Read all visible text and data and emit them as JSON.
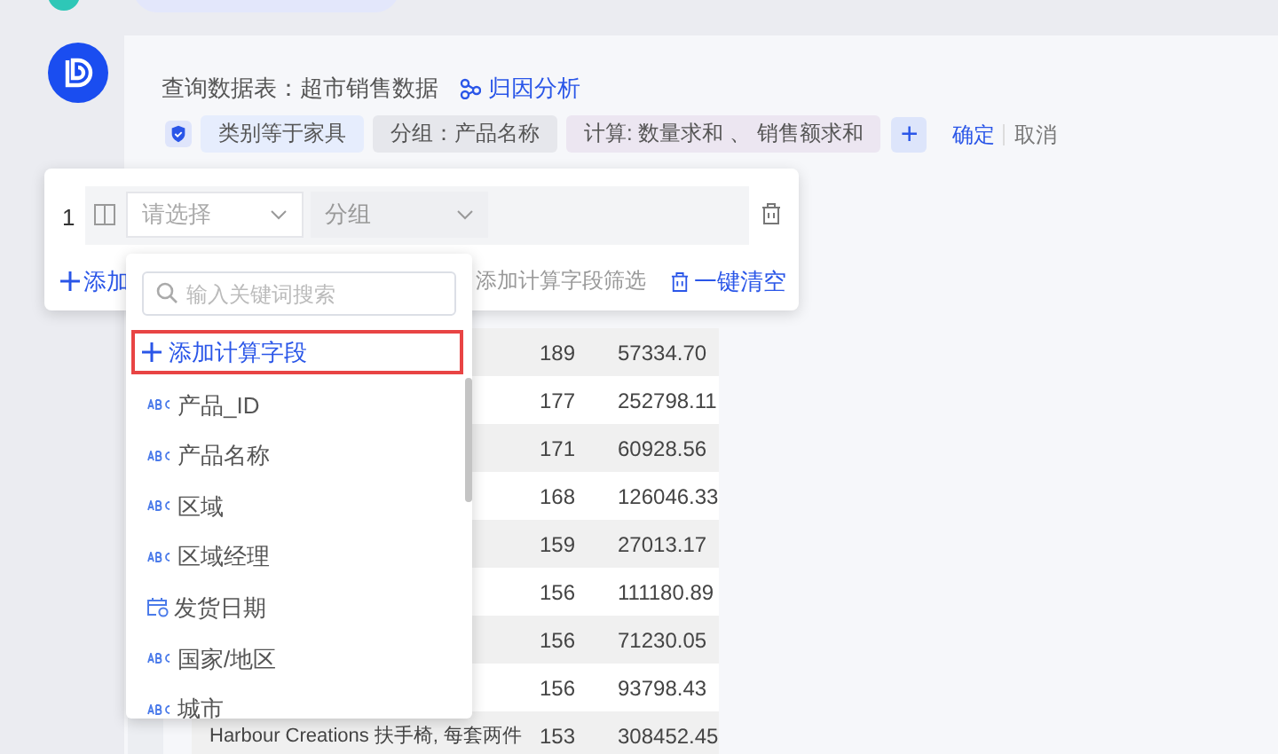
{
  "query": {
    "label": "查询数据表：超市销售数据",
    "link": "归因分析"
  },
  "chips": [
    {
      "kind": "filter",
      "text": "类别等于家具"
    },
    {
      "kind": "group",
      "text": "分组：产品名称"
    },
    {
      "kind": "calc",
      "text": "计算: 数量求和 、 销售额求和"
    }
  ],
  "add_button": "+",
  "confirm": "确定",
  "cancel": "取消",
  "condition_panel": {
    "row_index": "1",
    "field_select": {
      "placeholder": "请选择"
    },
    "group_select": {
      "value": "分组"
    },
    "add": "添加",
    "add_calc_filter": "添加计算字段筛选",
    "clear_all": "一键清空"
  },
  "dropdown": {
    "search": {
      "placeholder": "输入关键词搜索"
    },
    "add_calc_field": "添加计算字段",
    "items": [
      {
        "kind": "text",
        "label": "产品_ID"
      },
      {
        "kind": "text",
        "label": "产品名称"
      },
      {
        "kind": "text",
        "label": "区域"
      },
      {
        "kind": "text",
        "label": "区域经理"
      },
      {
        "kind": "date",
        "label": "发货日期"
      },
      {
        "kind": "text",
        "label": "国家/地区"
      },
      {
        "kind": "text",
        "label": "城市"
      }
    ]
  },
  "table": {
    "rows": [
      {
        "column_2": "189",
        "column_3": "57334.70"
      },
      {
        "column_2": "177",
        "column_3": "252798.11"
      },
      {
        "column_2": "171",
        "column_3": "60928.56"
      },
      {
        "column_2": "168",
        "column_3": "126046.33"
      },
      {
        "column_2": "159",
        "column_3": "27013.17"
      },
      {
        "column_2": "156",
        "column_3": "111180.89"
      },
      {
        "column_2": "156",
        "column_3": "71230.05"
      },
      {
        "column_2": "156",
        "column_3": "93798.43"
      },
      {
        "column_1": "Harbour Creations 扶手椅, 每套两件",
        "column_2": "153",
        "column_3": "308452.45"
      }
    ]
  }
}
